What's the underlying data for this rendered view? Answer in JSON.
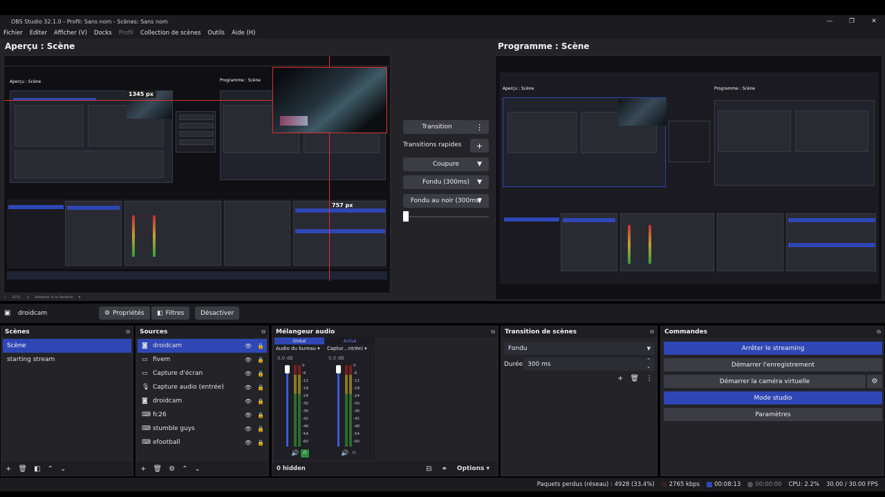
{
  "window": {
    "title": "OBS Studio 32.1.0 - Profil: Sans nom - Scènes: Sans nom",
    "controls": [
      "—",
      "❐",
      "✕"
    ]
  },
  "menu": [
    {
      "label": "Fichier",
      "enabled": true
    },
    {
      "label": "Editer",
      "enabled": true
    },
    {
      "label": "Afficher (V)",
      "enabled": true
    },
    {
      "label": "Docks",
      "enabled": true
    },
    {
      "label": "Profil",
      "enabled": false
    },
    {
      "label": "Collection de scènes",
      "enabled": true
    },
    {
      "label": "Outils",
      "enabled": true
    },
    {
      "label": "Aide (H)",
      "enabled": true
    }
  ],
  "preview": {
    "title": "Aperçu : Scène",
    "width_label": "1345 px",
    "height_label": "757 px",
    "zoom": "42%",
    "fit_label": "Adapter à la fenêtre",
    "inner_preview_title": "Aperçu : Scène",
    "inner_program_title": "Programme : Scène"
  },
  "program": {
    "title": "Programme : Scène",
    "inner_preview_title": "Aperçu : Scène",
    "inner_program_title": "Programme : Scène"
  },
  "transitions": {
    "transition_label": "Transition",
    "quick_label": "Transitions rapides",
    "items": [
      "Coupure",
      "Fondu (300ms)",
      "Fondu au noir (300ms)"
    ]
  },
  "source_toolbar": {
    "source_name": "droidcam",
    "properties": "Propriétés",
    "filters": "Filtres",
    "deactivate": "Désactiver"
  },
  "scenes": {
    "title": "Scènes",
    "items": [
      {
        "label": "Scène",
        "selected": true
      },
      {
        "label": "starting stream",
        "selected": false
      }
    ]
  },
  "sources": {
    "title": "Sources",
    "items": [
      {
        "label": "droidcam",
        "icon": "camera-icon",
        "selected": true
      },
      {
        "label": "fivem",
        "icon": "monitor-icon",
        "selected": false
      },
      {
        "label": "Capture d'écran",
        "icon": "monitor-icon",
        "selected": false
      },
      {
        "label": "Capture audio (entrée)",
        "icon": "microphone-icon",
        "selected": false
      },
      {
        "label": "droidcam",
        "icon": "camera-icon",
        "selected": false
      },
      {
        "label": "fc26",
        "icon": "gamepad-icon",
        "selected": false
      },
      {
        "label": "stumble guys",
        "icon": "gamepad-icon",
        "selected": false
      },
      {
        "label": "efootball",
        "icon": "gamepad-icon",
        "selected": false
      }
    ]
  },
  "mixer": {
    "title": "Mélangeur audio",
    "tabs": [
      "Global",
      "Activé"
    ],
    "channels": [
      {
        "name": "Audio du bureau",
        "db": "0.0 dB"
      },
      {
        "name": "Captur…ntrée)",
        "db": "0.0 dB"
      }
    ],
    "ticks": [
      "0",
      "-6",
      "-12",
      "-18",
      "-24",
      "-30",
      "-36",
      "-42",
      "-48",
      "-54",
      "-60"
    ],
    "hidden_label": "0 hidden",
    "options_label": "Options"
  },
  "scene_transition": {
    "title": "Transition de scènes",
    "selected": "Fondu",
    "duration_label": "Durée",
    "duration_value": "300 ms"
  },
  "commands": {
    "title": "Commandes",
    "buttons": [
      {
        "label": "Arrêter le streaming",
        "active": true
      },
      {
        "label": "Démarrer l'enregistrement",
        "active": false
      },
      {
        "label": "Démarrer la caméra virtuelle",
        "active": false
      },
      {
        "label": "Mode studio",
        "active": true
      },
      {
        "label": "Paramètres",
        "active": false
      }
    ]
  },
  "status": {
    "dropped": "Paquets perdus (réseau) : 4928 (33.4%)",
    "bitrate": "2765 kbps",
    "stream_time": "00:08:13",
    "rec_time": "00:00:00",
    "cpu": "CPU: 2.2%",
    "fps": "30.00 / 30.00 FPS"
  },
  "colors": {
    "accent": "#2f47b5",
    "bg": "#232328",
    "live": "#e04040"
  }
}
